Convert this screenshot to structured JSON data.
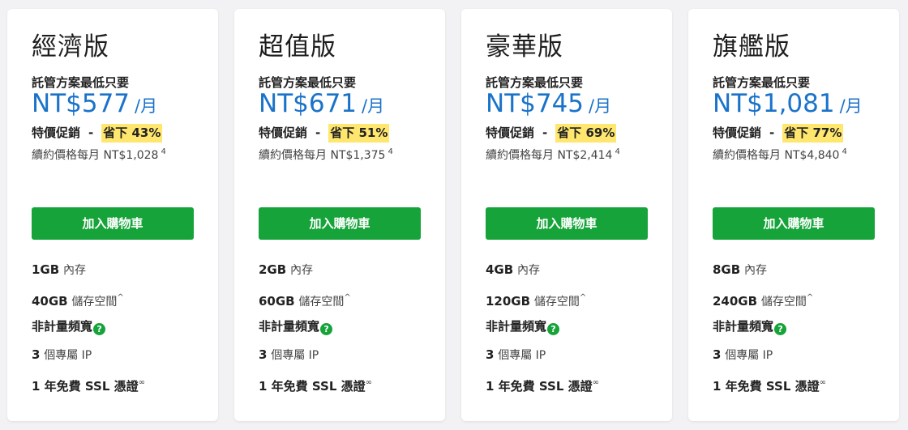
{
  "colors": {
    "price": "#1a73c9",
    "button": "#16a33a",
    "highlight": "#ffe66e",
    "background": "#f2f2f5"
  },
  "plans": [
    {
      "name": "經濟版",
      "min_label": "託管方案最低只要",
      "price": "NT$577",
      "per": "/月",
      "promo_label": "特價促銷",
      "promo_sep": "-",
      "save": "省下 43%",
      "renew_text": "續約價格每月 NT$1,028",
      "renew_note": "4",
      "cta": "加入購物車",
      "features": {
        "memory_value": "1GB",
        "memory_label": "內存",
        "storage_value": "40GB",
        "storage_label": "儲存空間",
        "storage_mark": "^",
        "bandwidth": "非計量頻寬",
        "help_icon": "?",
        "ip_value": "3",
        "ip_label": "個專屬 IP",
        "ssl_text": "1 年免費 SSL 憑證",
        "ssl_mark": "∞"
      }
    },
    {
      "name": "超值版",
      "min_label": "託管方案最低只要",
      "price": "NT$671",
      "per": "/月",
      "promo_label": "特價促銷",
      "promo_sep": "-",
      "save": "省下 51%",
      "renew_text": "續約價格每月 NT$1,375",
      "renew_note": "4",
      "cta": "加入購物車",
      "features": {
        "memory_value": "2GB",
        "memory_label": "內存",
        "storage_value": "60GB",
        "storage_label": "儲存空間",
        "storage_mark": "^",
        "bandwidth": "非計量頻寬",
        "help_icon": "?",
        "ip_value": "3",
        "ip_label": "個專屬 IP",
        "ssl_text": "1 年免費 SSL 憑證",
        "ssl_mark": "∞"
      }
    },
    {
      "name": "豪華版",
      "min_label": "託管方案最低只要",
      "price": "NT$745",
      "per": "/月",
      "promo_label": "特價促銷",
      "promo_sep": "-",
      "save": "省下 69%",
      "renew_text": "續約價格每月 NT$2,414",
      "renew_note": "4",
      "cta": "加入購物車",
      "features": {
        "memory_value": "4GB",
        "memory_label": "內存",
        "storage_value": "120GB",
        "storage_label": "儲存空間",
        "storage_mark": "^",
        "bandwidth": "非計量頻寬",
        "help_icon": "?",
        "ip_value": "3",
        "ip_label": "個專屬 IP",
        "ssl_text": "1 年免費 SSL 憑證",
        "ssl_mark": "∞"
      }
    },
    {
      "name": "旗艦版",
      "min_label": "託管方案最低只要",
      "price": "NT$1,081",
      "per": "/月",
      "promo_label": "特價促銷",
      "promo_sep": "-",
      "save": "省下 77%",
      "renew_text": "續約價格每月 NT$4,840",
      "renew_note": "4",
      "cta": "加入購物車",
      "features": {
        "memory_value": "8GB",
        "memory_label": "內存",
        "storage_value": "240GB",
        "storage_label": "儲存空間",
        "storage_mark": "^",
        "bandwidth": "非計量頻寬",
        "help_icon": "?",
        "ip_value": "3",
        "ip_label": "個專屬 IP",
        "ssl_text": "1 年免費 SSL 憑證",
        "ssl_mark": "∞"
      }
    }
  ]
}
